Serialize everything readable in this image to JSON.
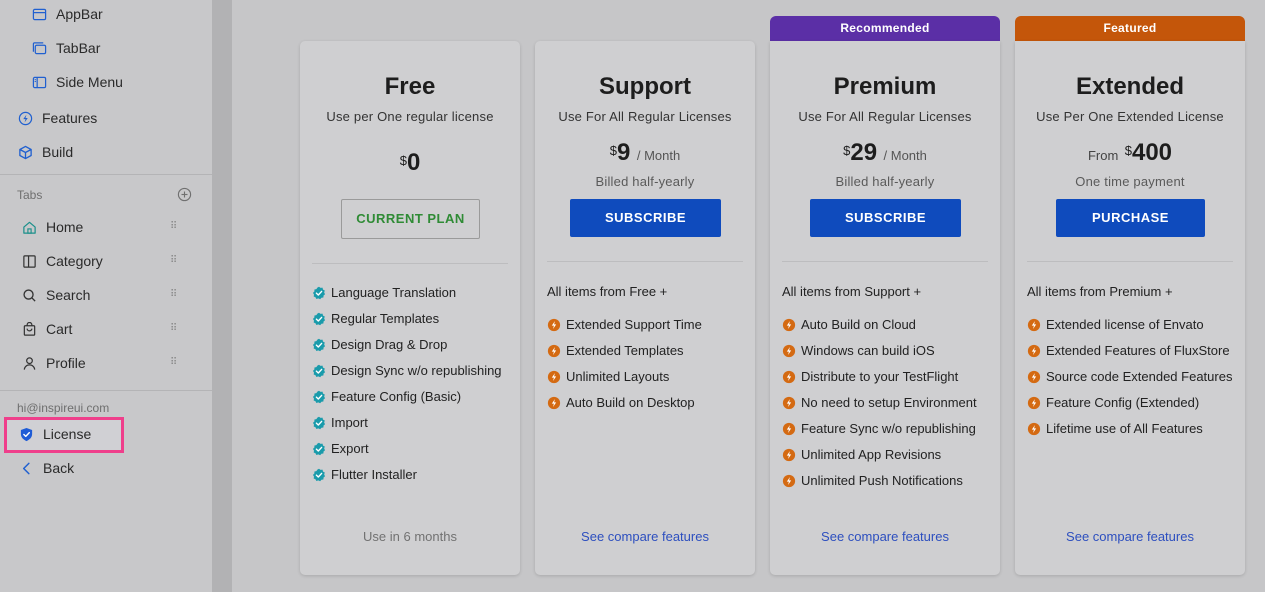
{
  "sidebar": {
    "layout_items": [
      {
        "label": "AppBar",
        "icon": "appbar-icon"
      },
      {
        "label": "TabBar",
        "icon": "tabbar-icon"
      },
      {
        "label": "Side Menu",
        "icon": "side-menu-icon"
      }
    ],
    "features_label": "Features",
    "build_label": "Build",
    "tabs_section_label": "Tabs",
    "tabs": [
      {
        "label": "Home",
        "icon": "home-icon"
      },
      {
        "label": "Category",
        "icon": "category-icon"
      },
      {
        "label": "Search",
        "icon": "search-icon"
      },
      {
        "label": "Cart",
        "icon": "cart-icon"
      },
      {
        "label": "Profile",
        "icon": "profile-icon"
      }
    ],
    "email": "hi@inspireui.com",
    "license_label": "License",
    "back_label": "Back"
  },
  "plans": [
    {
      "title": "Free",
      "subtitle": "Use per One regular license",
      "currency": "$",
      "amount": "0",
      "button": "CURRENT PLAN",
      "features": [
        "Language Translation",
        "Regular Templates",
        "Design Drag & Drop",
        "Design Sync w/o republishing",
        "Feature Config (Basic)",
        "Import",
        "Export",
        "Flutter Installer"
      ],
      "footer": "Use in 6 months"
    },
    {
      "title": "Support",
      "subtitle": "Use For All Regular Licenses",
      "currency": "$",
      "amount": "9",
      "period": "/ Month",
      "billed": "Billed half-yearly",
      "button": "SUBSCRIBE",
      "all_items": "All items from Free  +",
      "features": [
        "Extended Support Time",
        "Extended Templates",
        "Unlimited Layouts",
        "Auto Build on Desktop"
      ],
      "footer": "See compare features"
    },
    {
      "tag": "Recommended",
      "title": "Premium",
      "subtitle": "Use For All Regular Licenses",
      "currency": "$",
      "amount": "29",
      "period": "/ Month",
      "billed": "Billed half-yearly",
      "button": "SUBSCRIBE",
      "all_items": "All items from Support  +",
      "features": [
        "Auto Build on Cloud",
        "Windows can build iOS",
        "Distribute to your TestFlight",
        "No need to setup Environment",
        "Feature Sync w/o republishing",
        "Unlimited App Revisions",
        "Unlimited Push Notifications"
      ],
      "footer": "See compare features"
    },
    {
      "tag": "Featured",
      "title": "Extended",
      "subtitle": "Use Per One Extended License",
      "from": "From",
      "currency": "$",
      "amount": "400",
      "billed": "One time payment",
      "button": "PURCHASE",
      "all_items": "All items from Premium +",
      "features": [
        "Extended license of Envato",
        "Extended Features of FluxStore",
        "Source code Extended Features",
        "Feature Config (Extended)",
        "Lifetime use of All Features"
      ],
      "footer": "See compare features"
    }
  ],
  "colors": {
    "recommended_tag": "#5b2fa6",
    "featured_tag": "#c4560a",
    "primary_button": "#0f4bbd",
    "check_teal": "#1a9bab",
    "bolt_orange": "#d46a12",
    "license_highlight": "#ef3f8b"
  }
}
